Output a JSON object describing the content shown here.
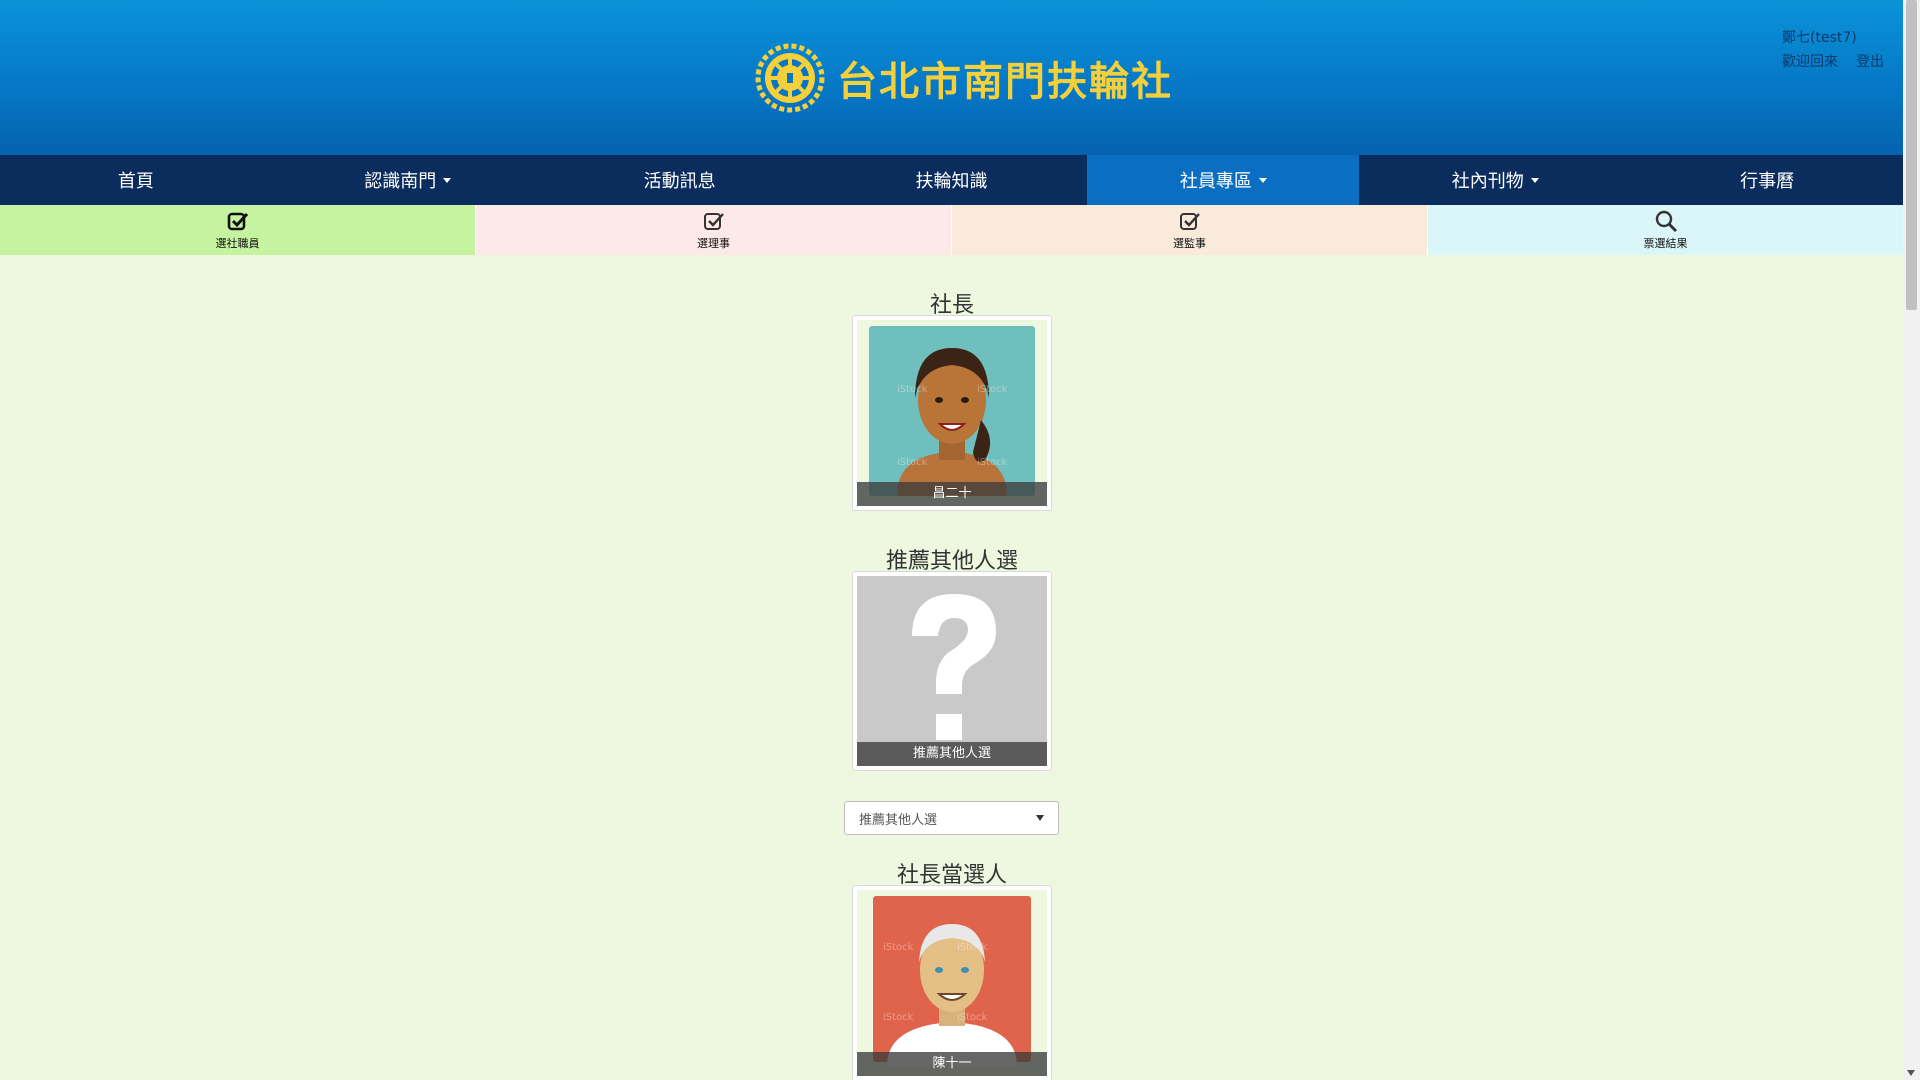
{
  "header": {
    "title": "台北市南門扶輪社",
    "user_name": "鄭七(test7)",
    "welcome": "歡迎回來",
    "logout": "登出",
    "colors": {
      "gold": "#f5d03a",
      "blue": "#0676c4"
    }
  },
  "mainnav": [
    {
      "label": "首頁",
      "dropdown": false
    },
    {
      "label": "認識南門",
      "dropdown": true
    },
    {
      "label": "活動訊息",
      "dropdown": false
    },
    {
      "label": "扶輪知識",
      "dropdown": false
    },
    {
      "label": "社員專區",
      "dropdown": true,
      "active": true
    },
    {
      "label": "社內刊物",
      "dropdown": true
    },
    {
      "label": "行事曆",
      "dropdown": false
    }
  ],
  "subnav": [
    {
      "label": "選社職員",
      "icon": "check-square-icon",
      "color": "#c5f3a0"
    },
    {
      "label": "選理事",
      "icon": "check-square-icon",
      "color": "#fde9e7"
    },
    {
      "label": "選監事",
      "icon": "check-square-icon",
      "color": "#faeadb"
    },
    {
      "label": "票選結果",
      "icon": "search-icon",
      "color": "#daf6f8"
    }
  ],
  "content": {
    "president_title": "社長",
    "president_name": "昌二十",
    "recommend_title": "推薦其他人選",
    "recommend_name": "推薦其他人選",
    "select_value": "推薦其他人選",
    "elected_title": "社長當選人",
    "elected_name": "陳十一",
    "watermark": "iStock"
  }
}
